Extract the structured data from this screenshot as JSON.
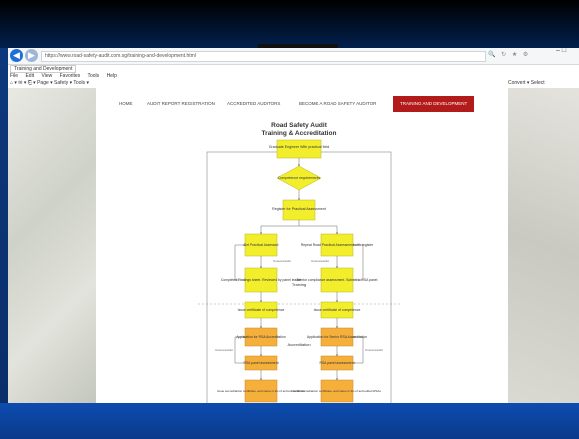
{
  "browser": {
    "url": "https://www.road-safety-audit.com.sg/training-and-development.html",
    "tab_title": "Training and Development",
    "menu": [
      "File",
      "Edit",
      "View",
      "Favorites",
      "Tools",
      "Help"
    ],
    "commands": "⌂ ▾  ✉ ▾  ⎗ ▾  Page ▾  Safety ▾  Tools ▾",
    "commands_right": "Convert ▾  Select"
  },
  "nav": {
    "items": [
      {
        "label": "HOME"
      },
      {
        "label": "AUDIT REPORT REGISTRATION"
      },
      {
        "label": "ACCREDITED AUDITORS"
      },
      {
        "label": "BECOME A ROAD SAFETY AUDITOR"
      },
      {
        "label": "TRAINING AND DEVELOPMENT"
      }
    ]
  },
  "flowchart": {
    "title_line1": "Road Safety Audit",
    "title_line2": "Training & Accreditation",
    "section_training": "Training",
    "section_accreditation": "Accreditation",
    "edge_label": "Unsuccessful",
    "nodes": {
      "start": "Graduate Engineer With practical field",
      "decision": "Competence requirements",
      "apply": "Register for Practical Assessment",
      "left1": "Get Practical Assessed",
      "right1": "Repeat Road Practical Assessment with register",
      "left2": "Completed Findings sheet. Reviewed by panel leader",
      "right2": "Mentor compliance assessment. Submit to RSA panel",
      "left3": "Issue certificate of competence",
      "right3": "Issue certificate of competence",
      "left4": "Application for RSA Accreditation",
      "right4": "Application for Senior RSA Accreditation",
      "left5": "RSA panel assessment",
      "right5": "RSA panel assessment",
      "left6": "Issue accreditation certificate, and name in list of accredited RSAs",
      "right6": "Issue accreditation certificate, and name in list of accredited RSAs"
    }
  },
  "colors": {
    "yellow": "#f2ee2c",
    "orange": "#f5b03c",
    "nav_active": "#b31b1b",
    "frame": "#0b2f6e"
  }
}
